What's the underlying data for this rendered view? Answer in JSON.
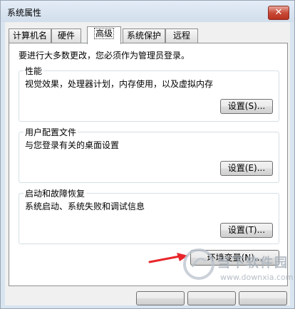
{
  "window": {
    "title": "系统属性",
    "close_glyph": "✕"
  },
  "tabs": [
    {
      "label": "计算机名",
      "active": false
    },
    {
      "label": "硬件",
      "active": false
    },
    {
      "label": "高级",
      "active": true
    },
    {
      "label": "系统保护",
      "active": false
    },
    {
      "label": "远程",
      "active": false
    }
  ],
  "advanced": {
    "intro": "要进行大多数更改，您必须作为管理员登录。",
    "performance": {
      "title": "性能",
      "desc": "视觉效果，处理器计划，内存使用，以及虚拟内存",
      "button": "设置(S)..."
    },
    "user_profiles": {
      "title": "用户配置文件",
      "desc": "与您登录有关的桌面设置",
      "button": "设置(E)..."
    },
    "startup": {
      "title": "启动和故障恢复",
      "desc": "系统启动、系统失败和调试信息",
      "button": "设置(T)..."
    },
    "env_button": "环境变量(N)..."
  },
  "annotation": {
    "arrow_color": "#e8262a"
  },
  "watermark": {
    "name": "当下软件园",
    "url": "www.downxia.com"
  }
}
